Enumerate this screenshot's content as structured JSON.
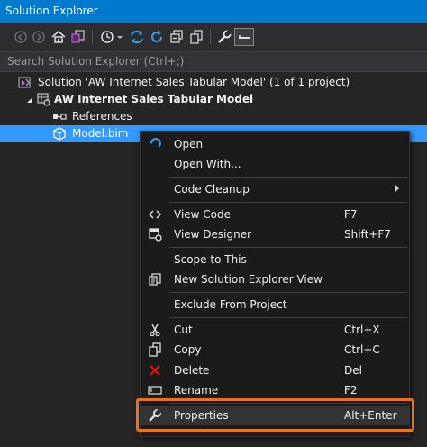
{
  "window": {
    "title": "Solution Explorer"
  },
  "search": {
    "placeholder": "Search Solution Explorer (Ctrl+;)"
  },
  "toolbar": {
    "icons": [
      "back-icon",
      "forward-icon",
      "home-icon",
      "switch-views-icon",
      "history-icon",
      "sync-icon",
      "refresh-icon",
      "collapse-all-icon",
      "show-all-files-icon",
      "properties-icon",
      "preview-icon"
    ]
  },
  "tree": {
    "solution": "Solution 'AW Internet Sales Tabular Model' (1 of 1 project)",
    "project": "AW Internet Sales Tabular Model",
    "references": "References",
    "model": "Model.bim"
  },
  "menu": {
    "open": "Open",
    "open_with": "Open With...",
    "code_cleanup": "Code Cleanup",
    "view_code": "View Code",
    "view_code_sc": "F7",
    "view_designer": "View Designer",
    "view_designer_sc": "Shift+F7",
    "scope": "Scope to This",
    "new_view": "New Solution Explorer View",
    "exclude": "Exclude From Project",
    "cut": "Cut",
    "cut_sc": "Ctrl+X",
    "copy": "Copy",
    "copy_sc": "Ctrl+C",
    "delete": "Delete",
    "delete_sc": "Del",
    "rename": "Rename",
    "rename_sc": "F2",
    "properties": "Properties",
    "properties_sc": "Alt+Enter"
  },
  "colors": {
    "accent": "#007acc",
    "selection": "#3399ff",
    "highlight_box": "#e8731f",
    "delete_icon": "#e51400",
    "open_icon": "#3c9be8"
  }
}
